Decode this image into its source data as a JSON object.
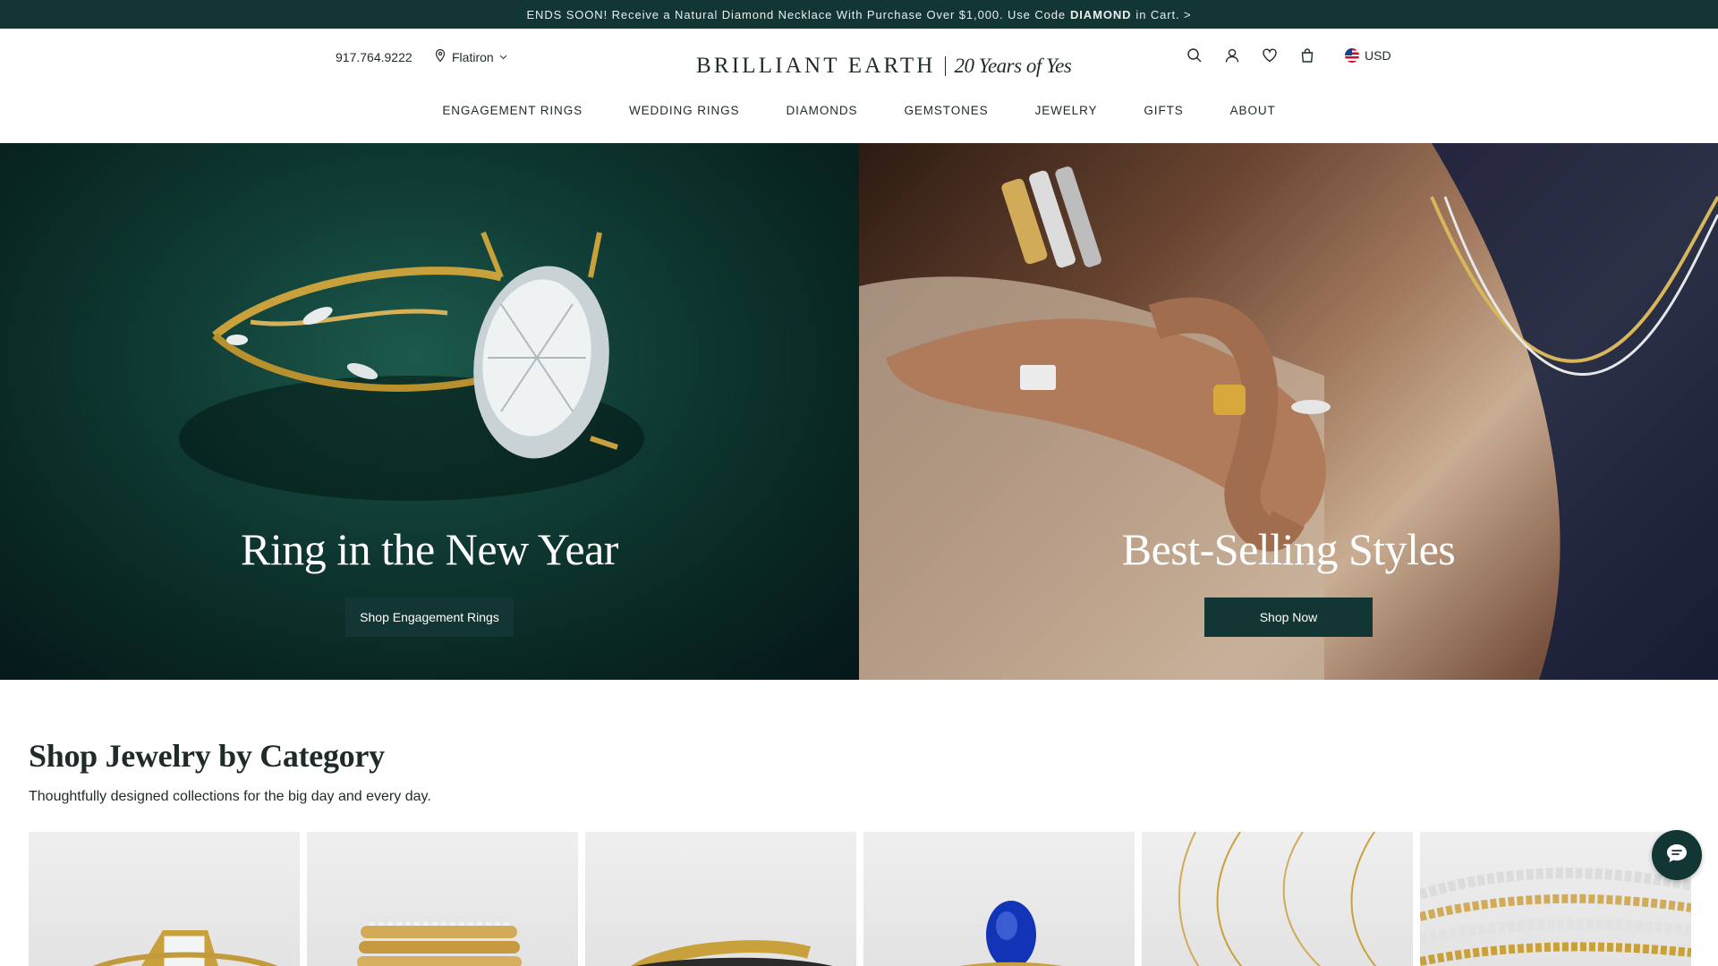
{
  "promo": {
    "text_before": "ENDS SOON! Receive a Natural Diamond Necklace With Purchase Over $1,000. Use Code",
    "code": "DIAMOND",
    "text_after": "in Cart. >"
  },
  "header": {
    "phone": "917.764.9222",
    "store": "Flatiron",
    "logo_word": "BRILLIANT EARTH",
    "logo_years": "20 Years of Yes",
    "currency": "USD",
    "icons": [
      "search-icon",
      "account-icon",
      "wishlist-icon",
      "bag-icon",
      "us-flag-icon"
    ]
  },
  "nav": {
    "items": [
      "ENGAGEMENT RINGS",
      "WEDDING RINGS",
      "DIAMONDS",
      "GEMSTONES",
      "JEWELRY",
      "GIFTS",
      "ABOUT"
    ]
  },
  "hero": {
    "left": {
      "title": "Ring in the New Year",
      "button": "Shop Engagement Rings"
    },
    "right": {
      "title": "Best-Selling Styles",
      "button": "Shop Now"
    }
  },
  "category": {
    "title": "Shop Jewelry by Category",
    "subtitle": "Thoughtfully designed collections for the big day and every day."
  },
  "colors": {
    "brand_dark": "#123634",
    "text": "#1f2a2a"
  }
}
